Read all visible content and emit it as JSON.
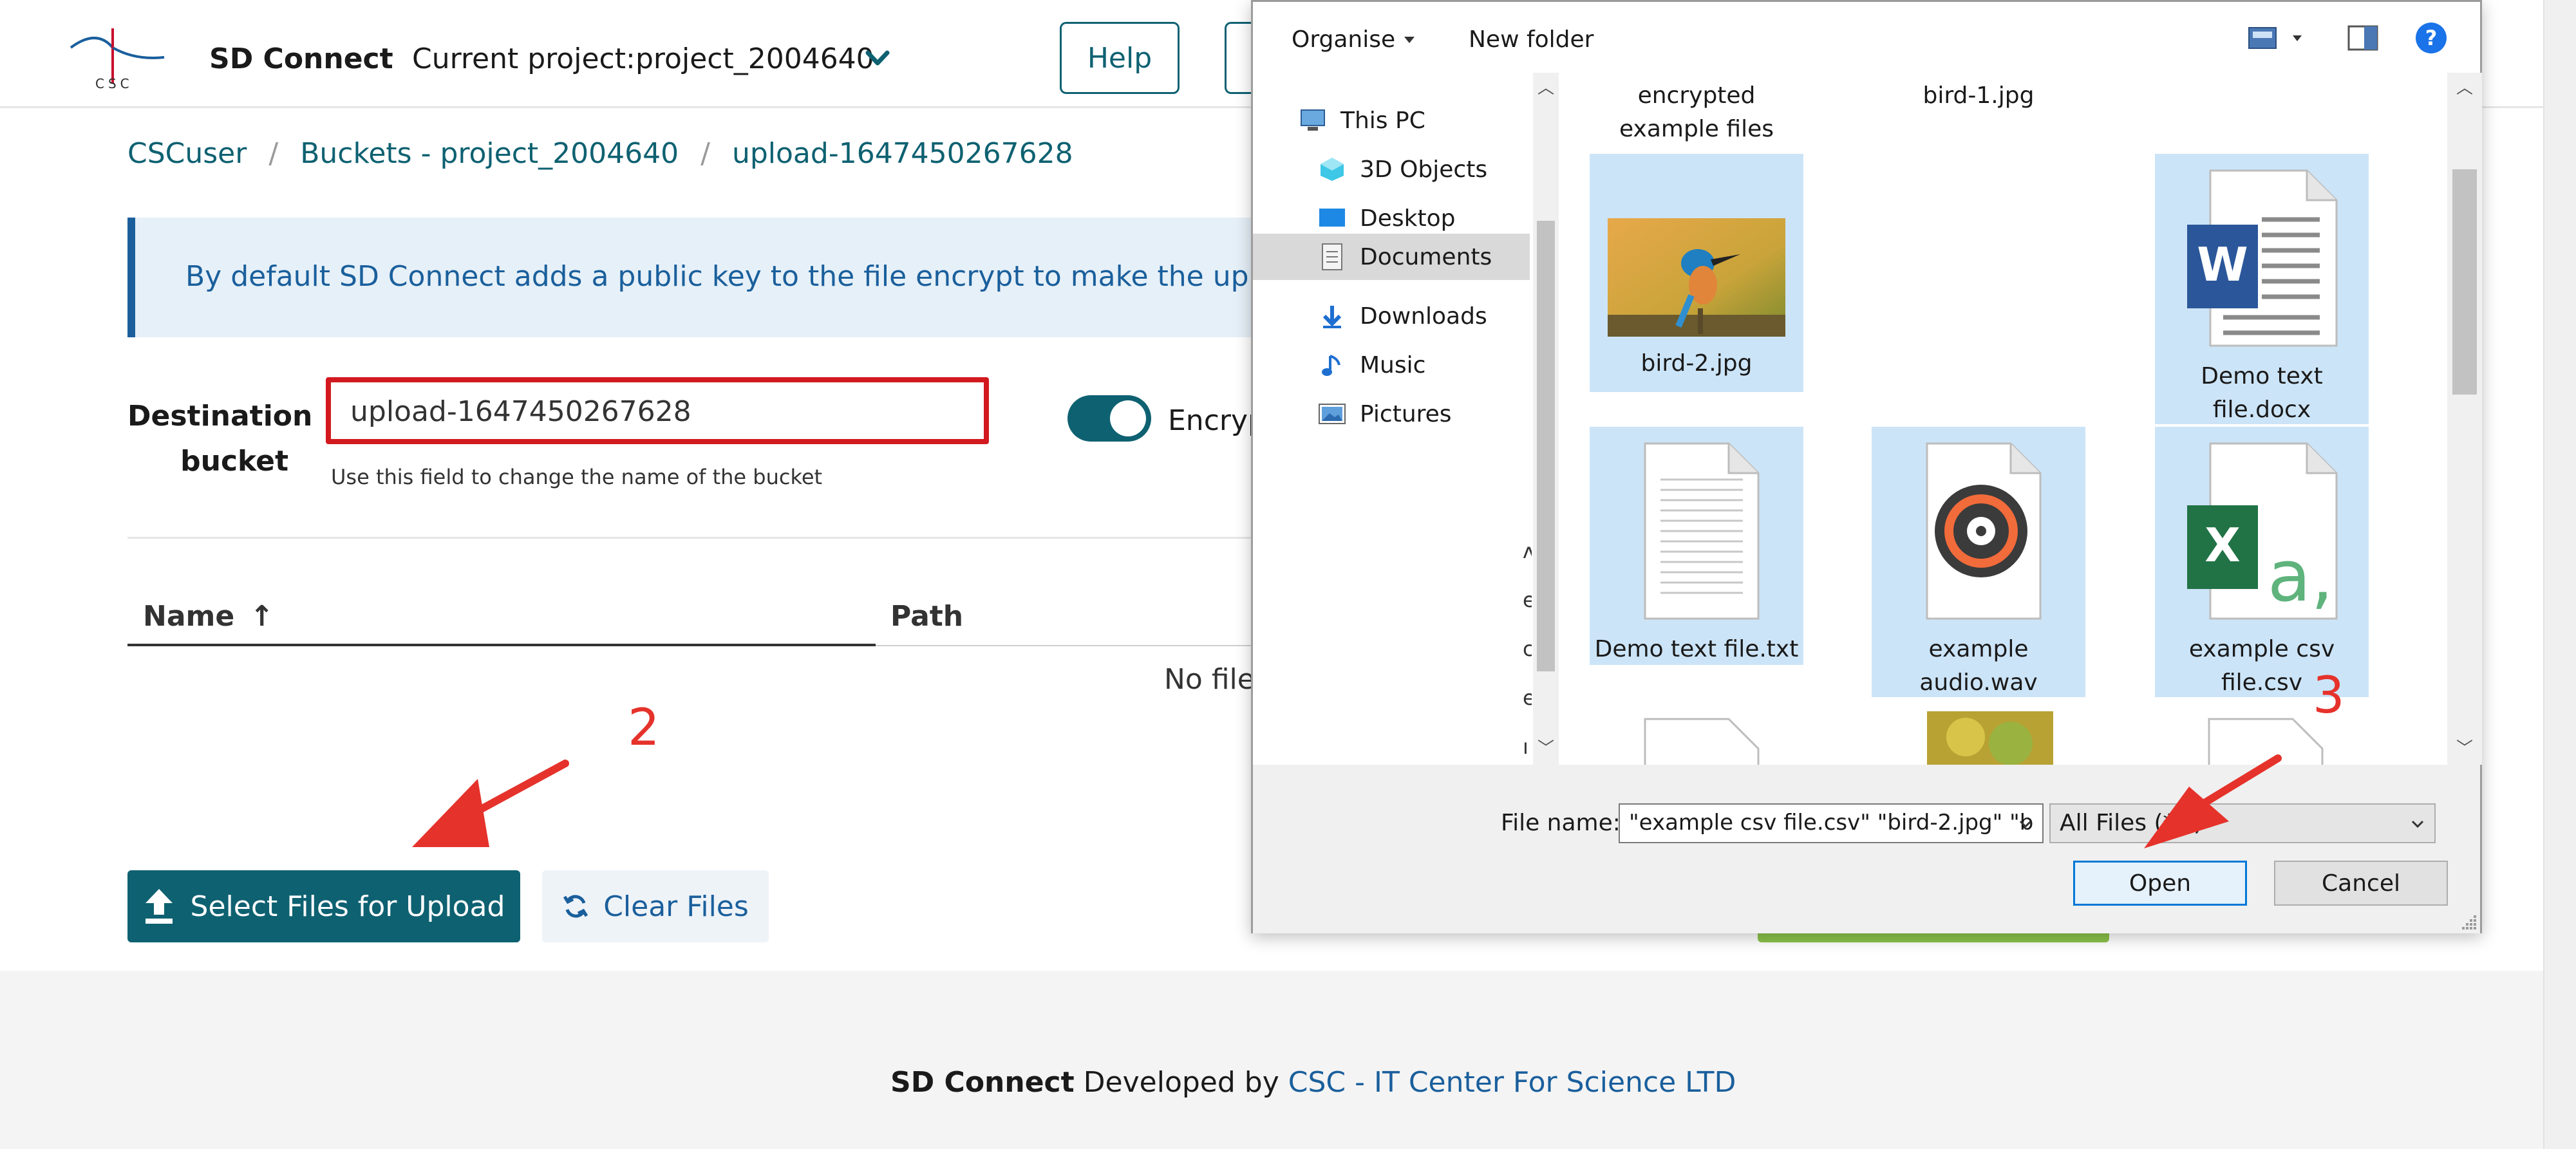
{
  "header": {
    "logo_text": "CSC",
    "app_name": "SD Connect",
    "current_project_label": "Current project:",
    "current_project_value": "project_2004640",
    "help_label": "Help"
  },
  "breadcrumb": [
    "CSCuser",
    "/",
    "Buckets - project_2004640",
    "/",
    "upload-1647450267628"
  ],
  "info_banner": "By default SD Connect adds a public key to the file encrypt to make the uploaded fi",
  "destination": {
    "label_line1": "Destination",
    "label_line2": "bucket",
    "value": "upload-1647450267628",
    "help": "Use this field to change the name of the bucket",
    "encrypt_label": "Encryp"
  },
  "table": {
    "col_name": "Name",
    "col_name_sort": "↑",
    "col_path": "Path",
    "empty_text": "No file"
  },
  "buttons": {
    "select_files": "Select Files for Upload",
    "clear_files": "Clear Files"
  },
  "annotations": {
    "step2": "2",
    "step3": "3"
  },
  "footer": {
    "brand": "SD Connect",
    "developed_by": "Developed by",
    "link": "CSC - IT Center For Science LTD"
  },
  "dialog": {
    "organise": "Organise",
    "new_folder": "New folder",
    "help_glyph": "?",
    "nav": [
      {
        "label": "This PC",
        "icon": "pc-icon"
      },
      {
        "label": "3D Objects",
        "icon": "3d-objects-icon"
      },
      {
        "label": "Desktop",
        "icon": "desktop-icon"
      },
      {
        "label": "Documents",
        "icon": "documents-icon"
      },
      {
        "label": "Downloads",
        "icon": "downloads-icon"
      },
      {
        "label": "Music",
        "icon": "music-icon"
      },
      {
        "label": "Pictures",
        "icon": "pictures-icon"
      }
    ],
    "clipped_letters": [
      "ʌ",
      "e",
      "c",
      "e",
      "ı"
    ],
    "files": {
      "encrypted_line1": "encrypted",
      "encrypted_line2": "example files",
      "bird1": "bird-1.jpg",
      "bird2": "bird-2.jpg",
      "docx_line1": "Demo text",
      "docx_line2": "file.docx",
      "txt": "Demo text file.txt",
      "wav_line1": "example",
      "wav_line2": "audio.wav",
      "csv_line1": "example csv",
      "csv_line2": "file.csv"
    },
    "file_name_label": "File name:",
    "file_name_value": "\"example csv file.csv\" \"bird-2.jpg\" \"b",
    "file_type_value": "All Files (*.*)",
    "open_label": "Open",
    "cancel_label": "Cancel"
  },
  "colors": {
    "brand_teal": "#0e6171",
    "link_blue": "#1a5f9c",
    "annotation_red": "#e5322b",
    "selection_blue": "#cce4f7"
  }
}
